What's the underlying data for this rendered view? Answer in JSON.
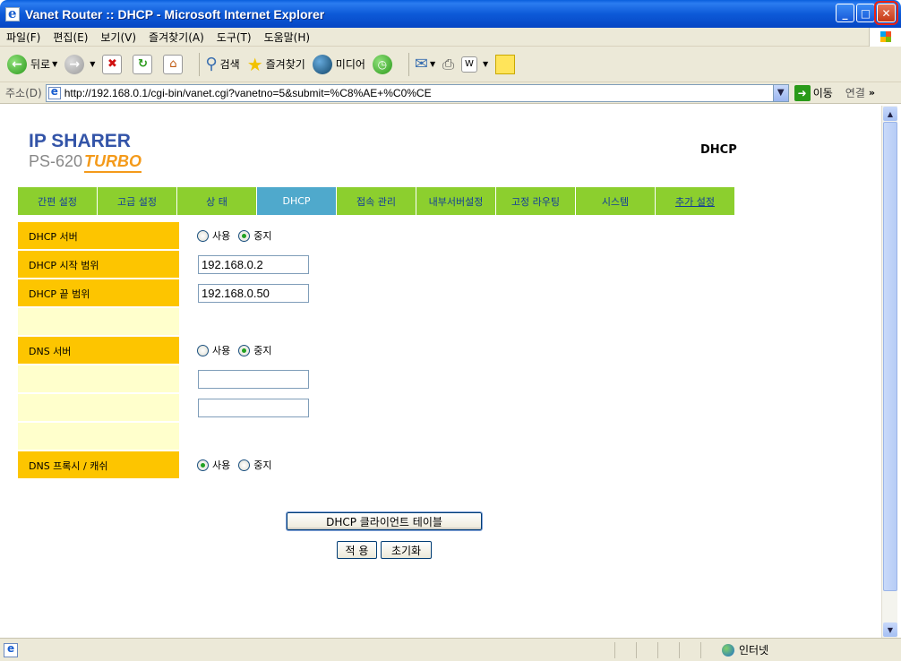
{
  "window": {
    "title": "Vanet Router :: DHCP - Microsoft Internet Explorer",
    "minimize": "_",
    "maximize": "□",
    "close": "✕"
  },
  "menu": [
    "파일(F)",
    "편집(E)",
    "보기(V)",
    "즐겨찾기(A)",
    "도구(T)",
    "도움말(H)"
  ],
  "toolbar": {
    "back": "뒤로",
    "search": "검색",
    "favorites": "즐겨찾기",
    "media": "미디어"
  },
  "address": {
    "label": "주소(D)",
    "url": "http://192.168.0.1/cgi-bin/vanet.cgi?vanetno=5&submit=%C8%AE+%C0%CE",
    "go": "이동",
    "links": "연결"
  },
  "logo": {
    "line1": "IP SHARER",
    "model": "PS-620",
    "edition": "TURBO"
  },
  "page_heading": "DHCP",
  "nav": [
    {
      "label": "간편 설정"
    },
    {
      "label": "고급 설정"
    },
    {
      "label": "상 태"
    },
    {
      "label": "DHCP"
    },
    {
      "label": "접속 관리"
    },
    {
      "label": "내부서버설정"
    },
    {
      "label": "고정 라우팅"
    },
    {
      "label": "시스템"
    },
    {
      "label": "추가 설정"
    }
  ],
  "form": {
    "dhcp_server": {
      "label": "DHCP 서버",
      "opt_use": "사용",
      "opt_stop": "중지",
      "selected": "중지"
    },
    "dhcp_start": {
      "label": "DHCP 시작 범위",
      "value": "192.168.0.2"
    },
    "dhcp_end": {
      "label": "DHCP 끝 범위",
      "value": "192.168.0.50"
    },
    "dns_server": {
      "label": "DNS 서버",
      "opt_use": "사용",
      "opt_stop": "중지",
      "selected": "중지",
      "dns1": "",
      "dns2": ""
    },
    "dns_proxy": {
      "label": "DNS 프록시 / 캐쉬",
      "opt_use": "사용",
      "opt_stop": "중지",
      "selected": "사용"
    }
  },
  "buttons": {
    "client_table": "DHCP 클라이언트 테이블",
    "apply": "적 용",
    "reset": "초기화"
  },
  "status": {
    "zone": "인터넷"
  }
}
